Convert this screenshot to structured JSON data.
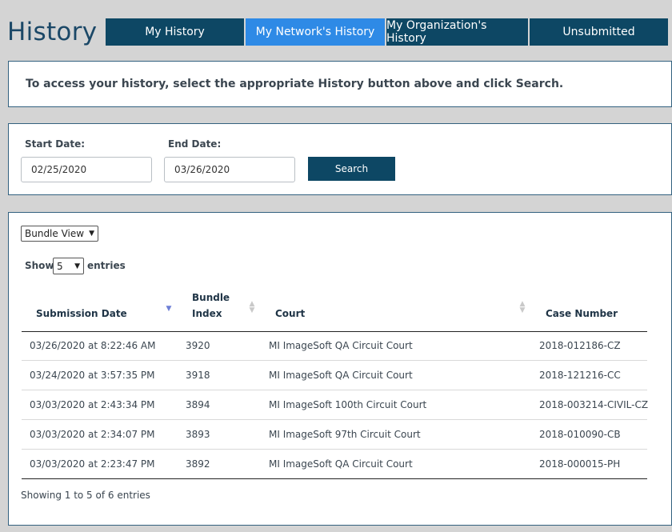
{
  "page": {
    "title": "History"
  },
  "tabs": [
    {
      "label": "My History",
      "active": false
    },
    {
      "label": "My Network's History",
      "active": true
    },
    {
      "label": "My Organization's History",
      "active": false
    },
    {
      "label": "Unsubmitted",
      "active": false
    }
  ],
  "info": {
    "message": "To access your history, select the appropriate History button above and click Search."
  },
  "search": {
    "start_label": "Start Date:",
    "start_value": "02/25/2020",
    "end_label": "End Date:",
    "end_value": "03/26/2020",
    "button_label": "Search"
  },
  "results": {
    "view_select": "Bundle View",
    "show_label": "Show",
    "show_value": "5",
    "entries_label": "entries",
    "columns": {
      "submission_date": "Submission Date",
      "bundle_index_line1": "Bundle",
      "bundle_index_line2": "Index",
      "court": "Court",
      "case_number": "Case Number"
    },
    "rows": [
      {
        "date": "03/26/2020 at 8:22:46 AM",
        "index": "3920",
        "court": "MI ImageSoft QA Circuit Court",
        "case": "2018-012186-CZ"
      },
      {
        "date": "03/24/2020 at 3:57:35 PM",
        "index": "3918",
        "court": "MI ImageSoft QA Circuit Court",
        "case": "2018-121216-CC"
      },
      {
        "date": "03/03/2020 at 2:43:34 PM",
        "index": "3894",
        "court": "MI ImageSoft 100th Circuit Court",
        "case": "2018-003214-CIVIL-CZ"
      },
      {
        "date": "03/03/2020 at 2:34:07 PM",
        "index": "3893",
        "court": "MI ImageSoft 97th Circuit Court",
        "case": "2018-010090-CB"
      },
      {
        "date": "03/03/2020 at 2:23:47 PM",
        "index": "3892",
        "court": "MI ImageSoft QA Circuit Court",
        "case": "2018-000015-PH"
      }
    ],
    "footer": "Showing 1 to 5 of 6 entries"
  },
  "colors": {
    "tab": "#0d4764",
    "tab_active": "#2e8ae6",
    "title": "#1b4867"
  },
  "icons": {
    "sort": "sort-icon",
    "sort_active": "sort-desc-icon",
    "dropdown": "chevron-down-icon"
  }
}
